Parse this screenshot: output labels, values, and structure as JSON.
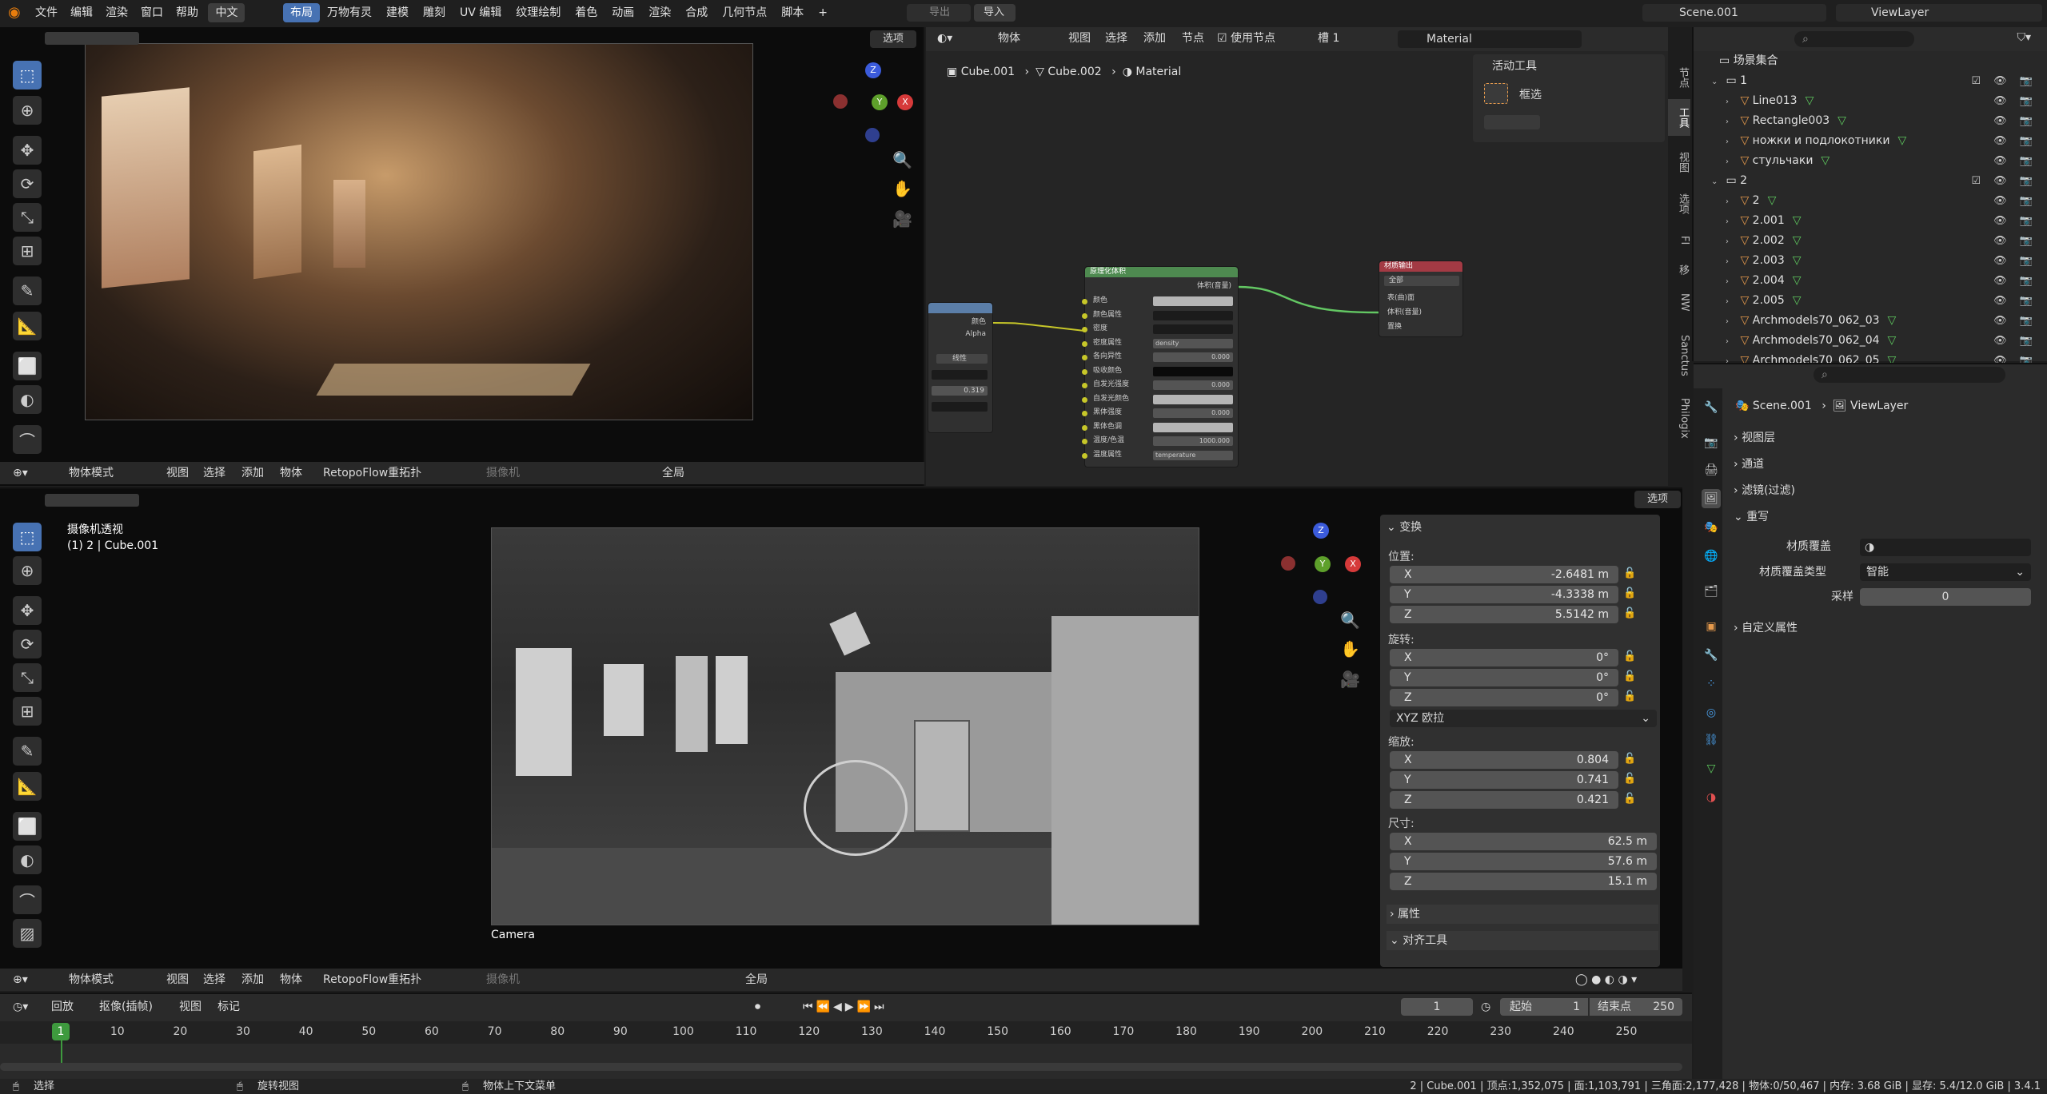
{
  "topbar": {
    "menus": [
      "文件",
      "编辑",
      "渲染",
      "窗口",
      "帮助"
    ],
    "lang_badge": "中文",
    "workspaces": [
      "布局",
      "万物有灵",
      "建模",
      "雕刻",
      "UV 编辑",
      "纹理绘制",
      "着色",
      "动画",
      "渲染",
      "合成",
      "几何节点",
      "脚本"
    ],
    "export_label": "导出",
    "import_label": "导入",
    "scene": "Scene.001",
    "view_layer": "ViewLayer"
  },
  "top_viewport": {
    "options_label": "选项",
    "footer": {
      "mode": "物体模式",
      "view": "视图",
      "select": "选择",
      "add": "添加",
      "object": "物体",
      "addon": "RetopoFlow重拓扑",
      "camera": "摄像机",
      "global": "全局"
    }
  },
  "node_editor": {
    "header": {
      "type": "物体",
      "view": "视图",
      "select": "选择",
      "add": "添加",
      "node": "节点",
      "use_nodes": "使用节点",
      "slot": "槽 1",
      "material": "Material"
    },
    "breadcrumb": [
      "Cube.001",
      "Cube.002",
      "Material"
    ],
    "active_tool_title": "活动工具",
    "active_tool": "框选",
    "side_tabs": [
      "节点",
      "工具",
      "视图",
      "选项",
      "FI",
      "移",
      "NW",
      "Sanctus",
      "Philogix"
    ],
    "node_left": {
      "labels": [
        "颜色",
        "Alpha",
        "线性"
      ],
      "value": "0.319"
    },
    "node_volume": {
      "title": "原理化体积",
      "output": "体积(音量)",
      "rows": [
        {
          "label": "颜色",
          "field": ""
        },
        {
          "label": "颜色属性",
          "field": ""
        },
        {
          "label": "密度",
          "field": ""
        },
        {
          "label": "密度属性",
          "field": "density"
        },
        {
          "label": "各向异性",
          "field": "0.000"
        },
        {
          "label": "吸收颜色",
          "field": ""
        },
        {
          "label": "自发光强度",
          "field": "0.000"
        },
        {
          "label": "自发光颜色",
          "field": ""
        },
        {
          "label": "黑体强度",
          "field": "0.000"
        },
        {
          "label": "黑体色调",
          "field": ""
        },
        {
          "label": "温度/色温",
          "field": "1000.000"
        },
        {
          "label": "温度属性",
          "field": "temperature"
        }
      ]
    },
    "node_output": {
      "title": "材质输出",
      "target": "全部",
      "rows": [
        "表(曲)面",
        "体积(音量)",
        "置换"
      ]
    }
  },
  "outliner": {
    "root": "场景集合",
    "rows": [
      {
        "name": "1",
        "kind": "collection",
        "depth": 0
      },
      {
        "name": "Line013",
        "kind": "mesh",
        "depth": 1
      },
      {
        "name": "Rectangle003",
        "kind": "mesh",
        "depth": 1
      },
      {
        "name": "ножки и подлокотники",
        "kind": "mesh",
        "depth": 1
      },
      {
        "name": "стульчаки",
        "kind": "mesh",
        "depth": 1
      },
      {
        "name": "2",
        "kind": "collection",
        "depth": 0
      },
      {
        "name": "2",
        "kind": "mesh",
        "depth": 1
      },
      {
        "name": "2.001",
        "kind": "mesh",
        "depth": 1
      },
      {
        "name": "2.002",
        "kind": "mesh",
        "depth": 1
      },
      {
        "name": "2.003",
        "kind": "mesh",
        "depth": 1
      },
      {
        "name": "2.004",
        "kind": "mesh",
        "depth": 1
      },
      {
        "name": "2.005",
        "kind": "mesh",
        "depth": 1
      },
      {
        "name": "Archmodels70_062_03",
        "kind": "mesh",
        "depth": 1
      },
      {
        "name": "Archmodels70_062_04",
        "kind": "mesh",
        "depth": 1
      },
      {
        "name": "Archmodels70_062_05",
        "kind": "mesh",
        "depth": 1
      }
    ]
  },
  "properties": {
    "scene": "Scene.001",
    "view_layer": "ViewLayer",
    "sections": [
      "视图层",
      "通道",
      "滤镜(过滤)"
    ],
    "override_title": "重写",
    "material_override_label": "材质覆盖",
    "override_type_label": "材质覆盖类型",
    "override_type_value": "智能",
    "samples_label": "采样",
    "samples_value": "0",
    "custom_props": "自定义属性"
  },
  "bottom_viewport": {
    "title": "摄像机透视",
    "subtitle": "(1) 2 | Cube.001",
    "camera_label": "Camera",
    "options_label": "选项",
    "npanel": {
      "transform_title": "变换",
      "location_label": "位置:",
      "location": {
        "x": "-2.6481 m",
        "y": "-4.3338 m",
        "z": "5.5142 m"
      },
      "rotation_label": "旋转:",
      "rotation": {
        "x": "0°",
        "y": "0°",
        "z": "0°"
      },
      "rotation_mode": "XYZ 欧拉",
      "scale_label": "缩放:",
      "scale": {
        "x": "0.804",
        "y": "0.741",
        "z": "0.421"
      },
      "dims_label": "尺寸:",
      "dims": {
        "x": "62.5 m",
        "y": "57.6 m",
        "z": "15.1 m"
      },
      "properties_title": "属性",
      "align_title": "对齐工具"
    },
    "footer": {
      "mode": "物体模式",
      "view": "视图",
      "select": "选择",
      "add": "添加",
      "object": "物体",
      "addon": "RetopoFlow重拓扑",
      "camera": "摄像机",
      "global": "全局"
    }
  },
  "timeline": {
    "playback": "回放",
    "keying": "抠像(插帧)",
    "view": "视图",
    "marker": "标记",
    "current_frame": "1",
    "start_label": "起始",
    "start": "1",
    "end_label": "结束点",
    "end": "250",
    "ticks": [
      "1",
      "10",
      "20",
      "30",
      "40",
      "50",
      "60",
      "70",
      "80",
      "90",
      "100",
      "110",
      "120",
      "130",
      "140",
      "150",
      "160",
      "170",
      "180",
      "190",
      "200",
      "210",
      "220",
      "230",
      "240",
      "250"
    ]
  },
  "statusbar": {
    "select": "选择",
    "rotate": "旋转视图",
    "context": "物体上下文菜单",
    "stats": "2 | Cube.001 | 顶点:1,352,075 | 面:1,103,791 | 三角面:2,177,428 | 物体:0/50,467 | 内存: 3.68 GiB | 显存: 5.4/12.0 GiB | 3.4.1"
  }
}
